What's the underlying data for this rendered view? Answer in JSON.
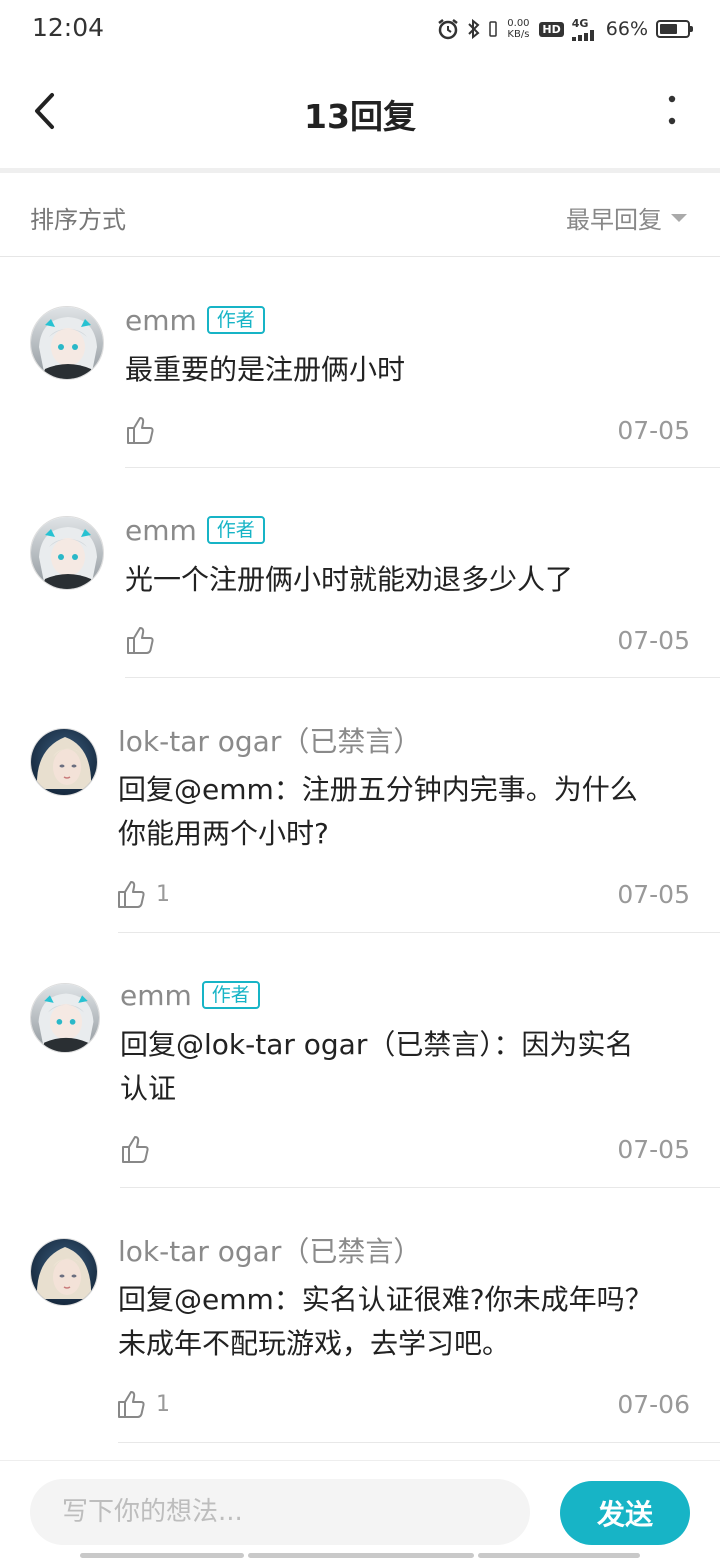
{
  "status_bar": {
    "time": "12:04",
    "net_speed_value": "0.00",
    "net_speed_unit": "KB/s",
    "hd": "HD",
    "network": "4G",
    "battery_percent": "66%",
    "battery_level": 0.66,
    "icons": [
      "alarm-icon",
      "bluetooth-icon",
      "hd-icon",
      "signal-icon",
      "battery-icon"
    ]
  },
  "header": {
    "title": "13回复",
    "back_icon": "chevron-left-icon",
    "more_icon": "more-vertical-icon"
  },
  "sort": {
    "label": "排序方式",
    "selected": "最早回复",
    "icon": "caret-down-icon"
  },
  "replies": [
    {
      "username": "emm",
      "tag": "作者",
      "text": "最重要的是注册俩小时",
      "likes": "",
      "date": "07-05",
      "avatar": "avatar-silver-hair"
    },
    {
      "username": "emm",
      "tag": "作者",
      "text": "光一个注册俩小时就能劝退多少人了",
      "likes": "",
      "date": "07-05",
      "avatar": "avatar-silver-hair"
    },
    {
      "username": "lok-tar ogar（已禁言）",
      "tag": "",
      "text_lines": [
        "回复@emm：注册五分钟内完事。为什么",
        "你能用两个小时?"
      ],
      "likes": "1",
      "date": "07-05",
      "avatar": "avatar-blonde-portrait"
    },
    {
      "username": "emm",
      "tag": "作者",
      "text_lines": [
        "回复@lok-tar ogar（已禁言）：因为实名",
        "认证"
      ],
      "likes": "",
      "date": "07-05",
      "avatar": "avatar-silver-hair"
    },
    {
      "username": "lok-tar ogar（已禁言）",
      "tag": "",
      "text_lines": [
        "回复@emm：实名认证很难?你未成年吗？",
        "未成年不配玩游戏，去学习吧。"
      ],
      "likes": "1",
      "date": "07-06",
      "avatar": "avatar-blonde-portrait"
    }
  ],
  "composer": {
    "placeholder": "写下你的想法...",
    "send_label": "发送"
  },
  "colors": {
    "accent": "#17b4c6",
    "muted_text": "#999999",
    "divider": "#e8e8e8"
  }
}
